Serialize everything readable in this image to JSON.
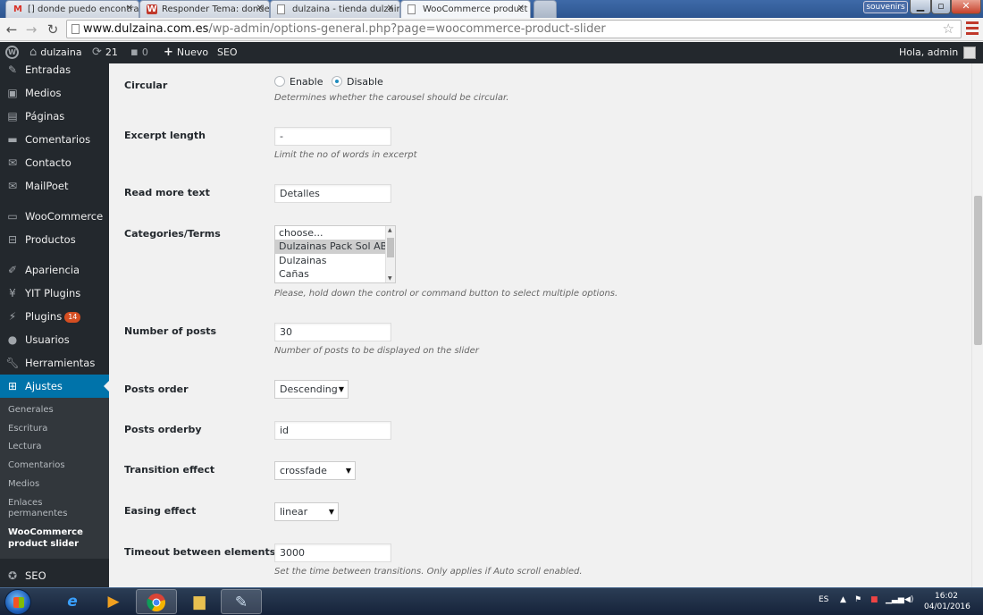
{
  "browser": {
    "tabs": [
      {
        "label": "[] donde puedo encontrar",
        "icon": "M"
      },
      {
        "label": "Responder Tema: donde p",
        "icon": "W"
      },
      {
        "label": "dulzaina - tienda dulzaina",
        "icon": ""
      },
      {
        "label": "WooCommerce product sl",
        "icon": ""
      }
    ],
    "user_chip": "souvenirs",
    "url_host": "www.dulzaina.com.es",
    "url_path": "/wp-admin/options-general.php?page=woocommerce-product-slider"
  },
  "admin_bar": {
    "site_name": "dulzaina",
    "updates_count": "21",
    "comments_count": "0",
    "new_label": "Nuevo",
    "seo_label": "SEO",
    "greeting": "Hola, admin"
  },
  "sidebar": {
    "items": [
      {
        "label": "Entradas",
        "icon": "pin-icon"
      },
      {
        "label": "Medios",
        "icon": "media-icon"
      },
      {
        "label": "Páginas",
        "icon": "pages-icon"
      },
      {
        "label": "Comentarios",
        "icon": "comments-icon"
      },
      {
        "label": "Contacto",
        "icon": "mail-icon"
      },
      {
        "label": "MailPoet",
        "icon": "mail-icon"
      },
      {
        "label": "WooCommerce",
        "icon": "woo-icon"
      },
      {
        "label": "Productos",
        "icon": "cart-icon"
      },
      {
        "label": "Apariencia",
        "icon": "brush-icon"
      },
      {
        "label": "YIT Plugins",
        "icon": "y-icon"
      },
      {
        "label": "Plugins",
        "icon": "plug-icon",
        "badge": "14"
      },
      {
        "label": "Usuarios",
        "icon": "user-icon"
      },
      {
        "label": "Herramientas",
        "icon": "wrench-icon"
      },
      {
        "label": "Ajustes",
        "icon": "settings-icon"
      }
    ],
    "submenu": [
      "Generales",
      "Escritura",
      "Lectura",
      "Comentarios",
      "Medios",
      "Enlaces permanentes",
      "WooCommerce product slider"
    ],
    "after": {
      "label": "SEO",
      "icon": "seo-icon"
    }
  },
  "form": {
    "circular": {
      "label": "Circular",
      "option_enable": "Enable",
      "option_disable": "Disable",
      "selected": "Disable",
      "description": "Determines whether the carousel should be circular."
    },
    "excerpt_length": {
      "label": "Excerpt length",
      "value": "-",
      "description": "Limit the no of words in excerpt"
    },
    "read_more": {
      "label": "Read more text",
      "value": "Detalles"
    },
    "categories": {
      "label": "Categories/Terms",
      "options": [
        "choose...",
        "Dulzainas Pack Sol ABS",
        "Dulzainas",
        "Cañas"
      ],
      "selected": "Dulzainas Pack Sol ABS",
      "description": "Please, hold down the control or command button to select multiple options."
    },
    "number_of_posts": {
      "label": "Number of posts",
      "value": "30",
      "description": "Number of posts to be displayed on the slider"
    },
    "posts_order": {
      "label": "Posts order",
      "value": "Descending"
    },
    "posts_orderby": {
      "label": "Posts orderby",
      "value": "id"
    },
    "transition_effect": {
      "label": "Transition effect",
      "value": "crossfade"
    },
    "easing_effect": {
      "label": "Easing effect",
      "value": "linear"
    },
    "timeout": {
      "label": "Timeout between elements",
      "value": "3000",
      "description": "Set the time between transitions. Only applies if Auto scroll enabled."
    }
  },
  "taskbar": {
    "language": "ES",
    "time": "16:02",
    "date": "04/01/2016"
  },
  "colors": {
    "admin_dark": "#23282d",
    "accent_blue": "#0073aa",
    "badge_orange": "#d54e21",
    "content_bg": "#f1f1f1"
  }
}
